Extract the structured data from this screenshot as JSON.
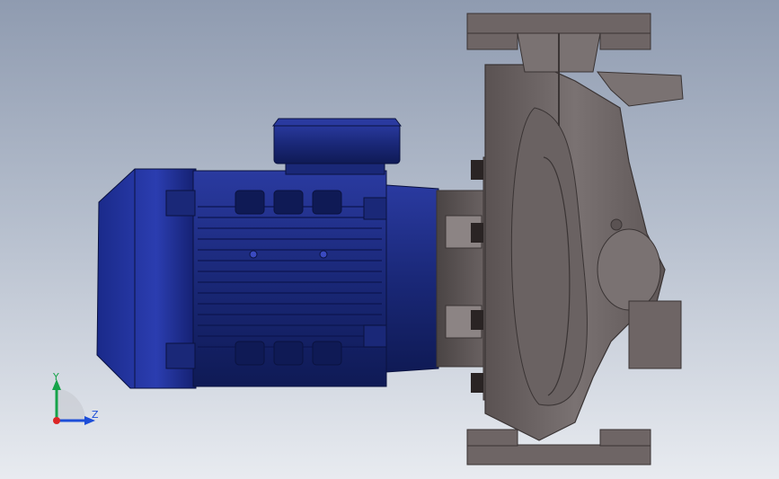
{
  "viewport": {
    "background_top": "#8f9bb0",
    "background_bottom": "#e8ebf0"
  },
  "model": {
    "motor_color": "#1e2f8c",
    "casing_color": "#6e6565"
  },
  "triad": {
    "y_label": "Y",
    "z_label": "Z",
    "y_color": "#16a34a",
    "z_color": "#1d4ed8",
    "origin_color": "#dc2626"
  }
}
